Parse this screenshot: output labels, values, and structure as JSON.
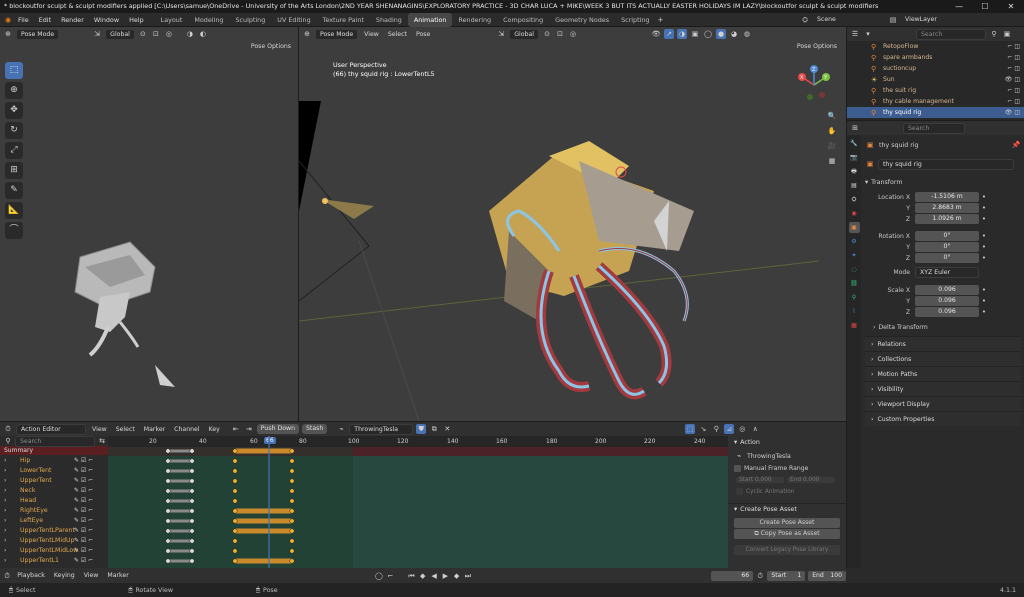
{
  "titlebar": {
    "title": "* blockoutfor sculpt & sculpt modifiers applied [C:\\Users\\samue\\OneDrive - University of the Arts London\\2ND YEAR SHENANAGINS\\EXPLORATORY PRACTICE - 3D CHAR LUCA + MIKE\\WEEK 3 BUT ITS ACTUALLY EASTER HOLIDAYS IM LAZY\\blockoutfor sculpt & sculpt modifiers",
    "min": "—",
    "max": "☐",
    "close": "✕"
  },
  "menu": [
    "File",
    "Edit",
    "Render",
    "Window",
    "Help"
  ],
  "workspaces": [
    "Layout",
    "Modeling",
    "Sculpting",
    "UV Editing",
    "Texture Paint",
    "Shading",
    "Animation",
    "Rendering",
    "Compositing",
    "Geometry Nodes",
    "Scripting"
  ],
  "active_workspace": "Animation",
  "scene": {
    "label": "Scene",
    "viewlayer": "ViewLayer"
  },
  "left_viewport": {
    "mode": "Pose Mode",
    "orientation": "Global",
    "pose_options": "Pose Options"
  },
  "main_viewport": {
    "mode": "Pose Mode",
    "menus": [
      "View",
      "Select",
      "Pose"
    ],
    "orientation": "Global",
    "pose_options": "Pose Options",
    "overlay_line1": "User Perspective",
    "overlay_line2": "(66) thy squid rig : LowerTentL5",
    "gizmo": {
      "x": "X",
      "y": "Y",
      "z": "Z"
    }
  },
  "outliner": {
    "search_placeholder": "Search",
    "items": [
      {
        "name": "RetopoFlow",
        "sel": false
      },
      {
        "name": "spare armbands",
        "sel": false
      },
      {
        "name": "suctioncup",
        "sel": false
      },
      {
        "name": "Sun",
        "sel": false
      },
      {
        "name": "the suit rig",
        "sel": false
      },
      {
        "name": "thy cable management",
        "sel": false
      },
      {
        "name": "thy squid rig",
        "sel": true
      }
    ]
  },
  "properties": {
    "search_placeholder": "Search",
    "object_name": "thy squid rig",
    "datablock": "thy squid rig",
    "transform_title": "Transform",
    "location_label": "Location X",
    "location": [
      "-1.5106 m",
      "2.8683 m",
      "1.0926 m"
    ],
    "rotation_label": "Rotation X",
    "rotation": [
      "0°",
      "0°",
      "0°"
    ],
    "mode_label": "Mode",
    "mode_value": "XYZ Euler",
    "scale_label": "Scale X",
    "scale": [
      "0.096",
      "0.096",
      "0.096"
    ],
    "axis": [
      "Y",
      "Z"
    ],
    "delta": "Delta Transform",
    "panels": [
      "Relations",
      "Collections",
      "Motion Paths",
      "Visibility",
      "Viewport Display",
      "Custom Properties"
    ]
  },
  "action_editor": {
    "editor": "Action Editor",
    "menus": [
      "View",
      "Select",
      "Marker",
      "Channel",
      "Key"
    ],
    "push_down": "Push Down",
    "stash": "Stash",
    "action_name": "ThrowingTesla",
    "search_placeholder": "Search",
    "ruler": [
      "20",
      "40",
      "60",
      "66",
      "80",
      "100",
      "120",
      "140",
      "160",
      "180",
      "200",
      "220",
      "240"
    ],
    "current_frame": "66",
    "summary": "Summary",
    "channels": [
      "Hip",
      "LowerTent",
      "UpperTent",
      "Neck",
      "Head",
      "RightEye",
      "LeftEye",
      "UpperTentLParent",
      "UpperTentLMidUp",
      "UpperTentLMidLow",
      "UpperTentL1"
    ],
    "side": {
      "action_header": "Action",
      "action_name": "ThrowingTesla",
      "manual_frame_range": "Manual Frame Range",
      "start_label": "Start",
      "start_val": "0.000",
      "end_label": "End",
      "end_val": "0.000",
      "cyclic": "Cyclic Animation",
      "create_pose_asset_header": "Create Pose Asset",
      "create_pose_asset_btn": "Create Pose Asset",
      "copy_pose_asset": "Copy Pose as Asset",
      "legacy": "Convert Legacy Pose Library"
    }
  },
  "timeline": {
    "menus": [
      "Playback",
      "Keying",
      "View",
      "Marker"
    ],
    "frame": "66",
    "start_label": "Start",
    "start": "1",
    "end_label": "End",
    "end": "100"
  },
  "statusbar": {
    "select": "Select",
    "rotate": "Rotate View",
    "pose": "Pose",
    "version": "4.1.1"
  }
}
